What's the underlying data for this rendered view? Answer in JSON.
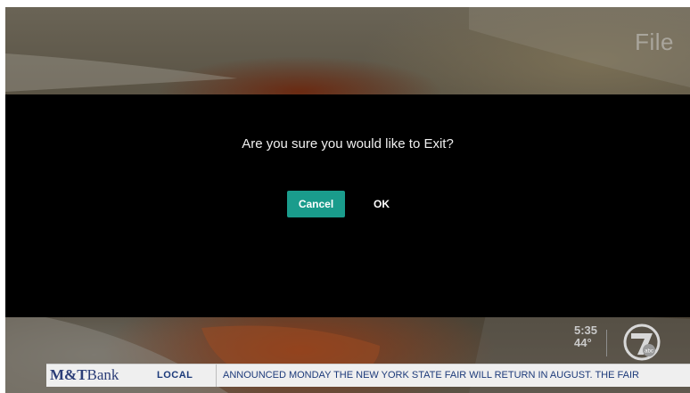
{
  "background": {
    "title": "File"
  },
  "dialog": {
    "message": "Are you sure you would like to Exit?",
    "cancel_label": "Cancel",
    "ok_label": "OK",
    "accent_color": "#1a9c8c"
  },
  "overlay": {
    "time": "5:35",
    "temperature": "44°",
    "station_logo": "abc-7-logo"
  },
  "ticker": {
    "sponsor_strong": "M&T",
    "sponsor_rest": "Bank",
    "category": "LOCAL",
    "text": "ANNOUNCED MONDAY THE NEW YORK STATE FAIR WILL RETURN IN AUGUST. THE FAIR"
  }
}
